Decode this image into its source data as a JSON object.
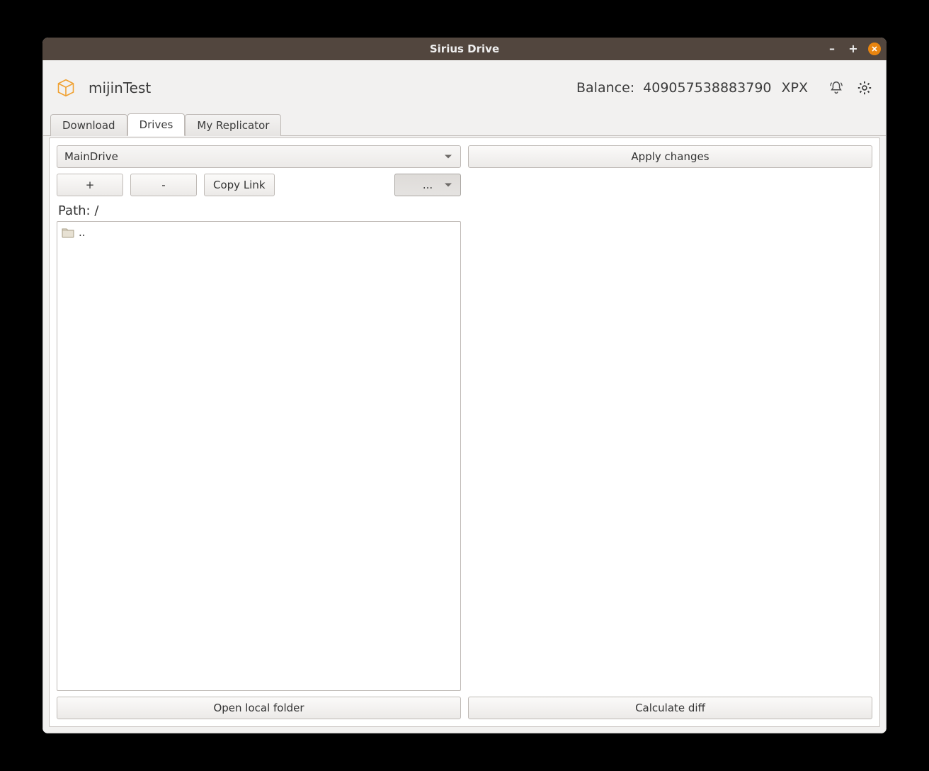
{
  "window": {
    "title": "Sirius Drive"
  },
  "header": {
    "profile_name": "mijinTest",
    "balance_label": "Balance:",
    "balance_value": "409057538883790",
    "balance_unit": "XPX"
  },
  "tabs": {
    "download": "Download",
    "drives": "Drives",
    "my_replicator": "My Replicator"
  },
  "drives_tab": {
    "selected_drive": "MainDrive",
    "apply_changes": "Apply changes",
    "add": "+",
    "remove": "-",
    "copy_link": "Copy Link",
    "more": "...",
    "path_label": "Path: /",
    "parent_dir": "..",
    "open_local_folder": "Open local folder",
    "calculate_diff": "Calculate diff"
  }
}
